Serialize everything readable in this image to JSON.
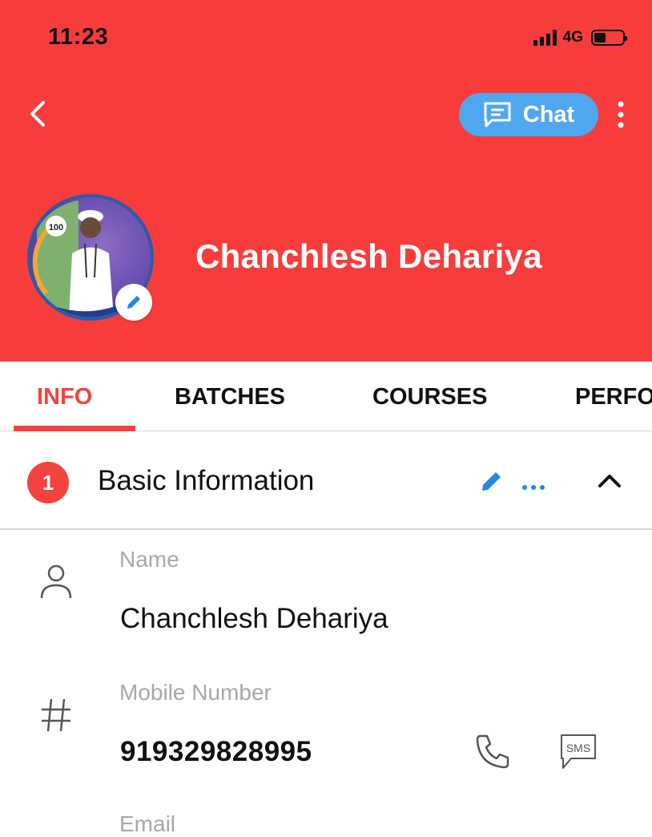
{
  "status_bar": {
    "time": "11:23",
    "network": "4G"
  },
  "header": {
    "chat_label": "Chat",
    "profile_name": "Chanchlesh Dehariya",
    "color": "#f73d3c",
    "chat_color": "#4fa7ef"
  },
  "tabs": [
    {
      "label": "INFO",
      "active": true
    },
    {
      "label": "BATCHES",
      "active": false
    },
    {
      "label": "COURSES",
      "active": false
    },
    {
      "label": "PERFO",
      "active": false
    }
  ],
  "section": {
    "step": "1",
    "title": "Basic Information"
  },
  "fields": {
    "name": {
      "label": "Name",
      "value": "Chanchlesh Dehariya",
      "icon": "person-icon"
    },
    "mobile": {
      "label": "Mobile Number",
      "value": "919329828995",
      "icon": "hash-icon",
      "actions": [
        "phone-icon",
        "sms-icon"
      ],
      "sms_text": "SMS"
    },
    "email": {
      "label": "Email"
    }
  },
  "avatar": {
    "icon": "profile-photo",
    "badge_text": "100"
  }
}
